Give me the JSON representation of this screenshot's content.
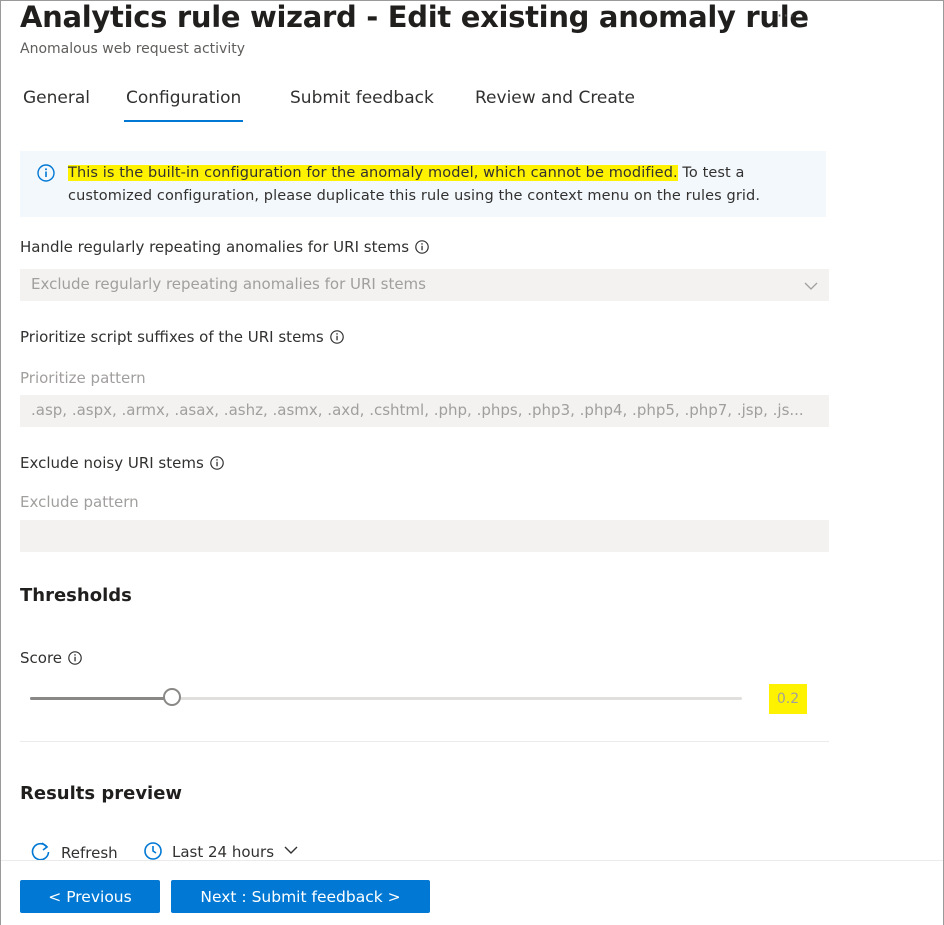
{
  "header": {
    "title": "Analytics rule wizard - Edit existing anomaly rule",
    "more_label": "···",
    "subtitle": "Anomalous web request activity"
  },
  "tabs": [
    {
      "label": "General",
      "active": false
    },
    {
      "label": "Configuration",
      "active": true
    },
    {
      "label": "Submit feedback",
      "active": false
    },
    {
      "label": "Review and Create",
      "active": false
    }
  ],
  "banner": {
    "icon": "info-icon",
    "highlighted_text": "This is the built-in configuration for the anomaly model, which cannot be modified.",
    "text": " To test a customized configuration, please duplicate this rule using the context menu on the rules grid."
  },
  "form": {
    "repeating": {
      "label": "Handle regularly repeating anomalies for URI stems",
      "value": "Exclude regularly repeating anomalies for URI stems"
    },
    "prioritize": {
      "label": "Prioritize script suffixes of the URI stems",
      "sublabel": "Prioritize pattern",
      "value": ".asp, .aspx, .armx, .asax, .ashz, .asmx, .axd, .cshtml, .php, .phps, .php3, .php4, .php5, .php7, .jsp, .js..."
    },
    "exclude": {
      "label": "Exclude noisy URI stems",
      "sublabel": "Exclude pattern",
      "value": ""
    }
  },
  "thresholds": {
    "heading": "Thresholds",
    "score_label": "Score",
    "score_value": "0.2",
    "slider_fraction": 0.2
  },
  "results": {
    "heading": "Results preview",
    "refresh_label": "Refresh",
    "time_range": "Last 24 hours"
  },
  "footer": {
    "previous_label": "< Previous",
    "next_label": "Next : Submit feedback >"
  },
  "colors": {
    "accent": "#0078d4",
    "highlight": "#fff200",
    "banner_bg": "#f3f8fd"
  }
}
